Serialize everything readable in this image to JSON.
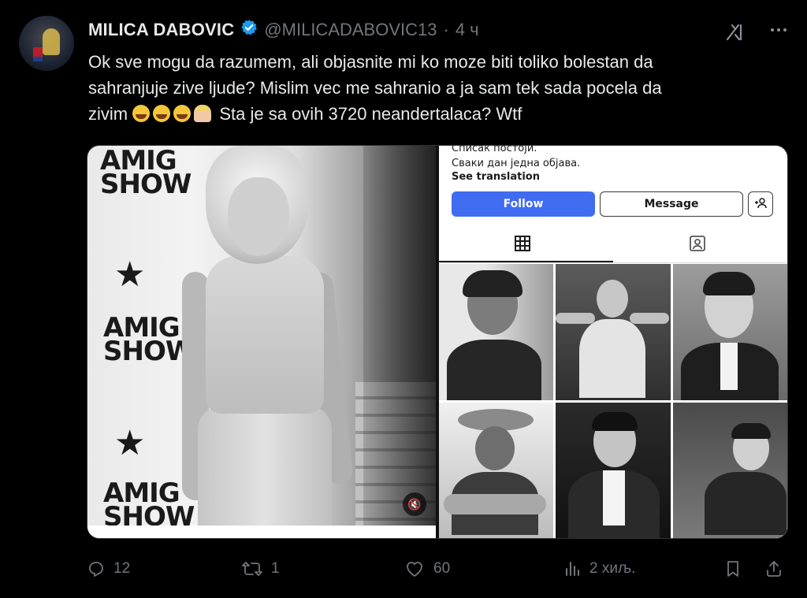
{
  "author": {
    "name": "MILICA DABOVIC",
    "handle": "@MILICADABOVIC13",
    "separator": "·",
    "time": "4 ч"
  },
  "icons": {
    "verified": "verified-badge-icon",
    "grok": "grok-icon",
    "more": "more-icon"
  },
  "tweet": {
    "line1": "Ok sve mogu da razumem, ali objasnite mi ko moze biti toliko bolestan da",
    "line2": "sahranjuje zive ljude? Mislim vec me sahranio a ja sam tek sada pocela da",
    "line3_start": "zivim",
    "line3_end": "Sta je sa ovih 3720 neandertalaca? Wtf"
  },
  "media": {
    "left_photo": {
      "logo_line1": "AMIG",
      "logo_line2": "SHOW"
    },
    "profile": {
      "bio_line1": "Списак постоји.",
      "bio_line2": "Сваки дан једна објава.",
      "see_translation": "See translation",
      "follow_label": "Follow",
      "message_label": "Message"
    }
  },
  "actions": {
    "replies": "12",
    "reposts": "1",
    "likes": "60",
    "views": "2 хиљ."
  },
  "colors": {
    "background": "#000000",
    "text": "#e7e9ea",
    "muted": "#71767b",
    "verified": "#1d9bf0",
    "follow_button": "#3f6cf0"
  }
}
